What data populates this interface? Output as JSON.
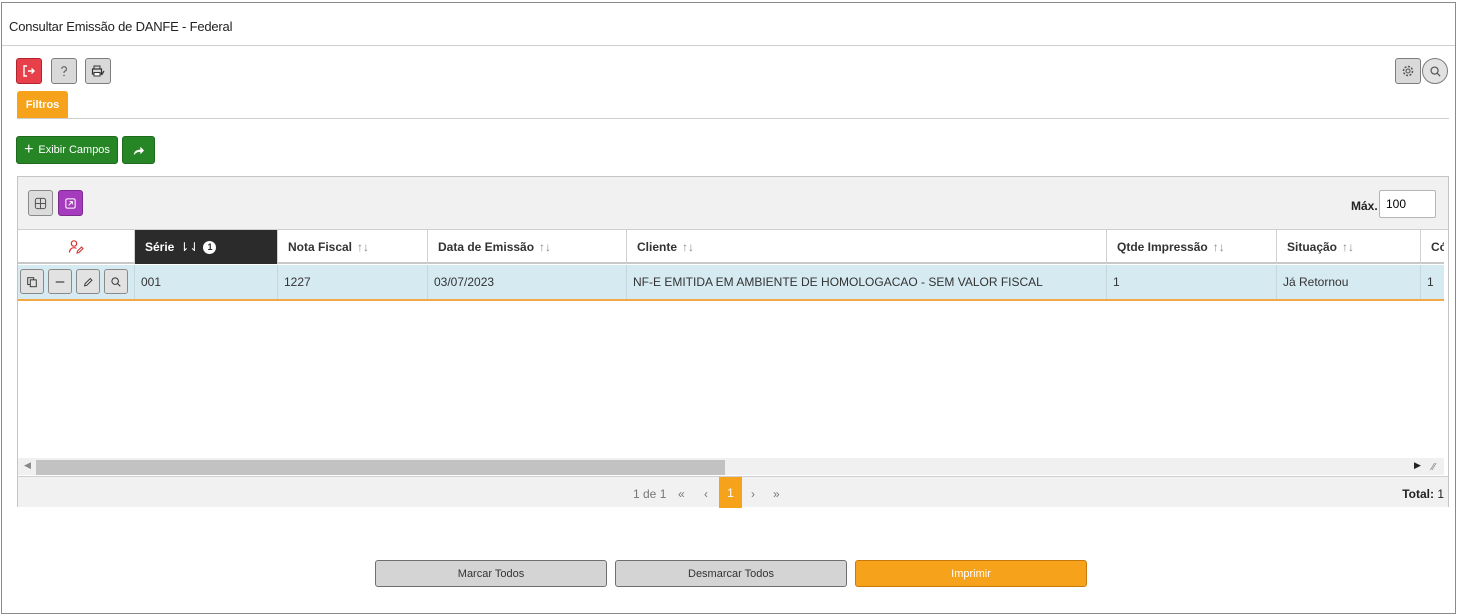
{
  "window": {
    "title": "Consultar Emissão de DANFE - Federal"
  },
  "toolbar": {
    "exit_icon": "exit-icon",
    "help_icon": "help-icon",
    "print_icon": "printer-icon",
    "settings_icon": "gear-icon",
    "search_icon": "search-icon"
  },
  "tabs": [
    {
      "label": "Filtros",
      "active": true
    }
  ],
  "actions": {
    "show_fields_label": "Exibir Campos"
  },
  "grid": {
    "max_label": "Máx.",
    "max_value": "100",
    "columns": [
      {
        "label": "Série",
        "sorted": true,
        "sort_order": "1"
      },
      {
        "label": "Nota Fiscal"
      },
      {
        "label": "Data de Emissão"
      },
      {
        "label": "Cliente"
      },
      {
        "label": "Qtde Impressão"
      },
      {
        "label": "Situação"
      },
      {
        "label": "Cód"
      }
    ],
    "rows": [
      {
        "serie": "001",
        "nota_fiscal": "1227",
        "data_emissao": "03/07/2023",
        "cliente": "NF-E EMITIDA EM AMBIENTE DE HOMOLOGACAO - SEM VALOR FISCAL",
        "qtde_impressao": "1",
        "situacao": "Já Retornou",
        "cod": "1"
      }
    ]
  },
  "pagination": {
    "summary": "1 de 1",
    "first": "«",
    "prev": "‹",
    "current": "1",
    "next": "›",
    "last": "»",
    "total_label": "Total:",
    "total_value": "1"
  },
  "footer": {
    "mark_all": "Marcar Todos",
    "unmark_all": "Desmarcar Todos",
    "print": "Imprimir"
  },
  "colors": {
    "accent": "#f7a21b",
    "success": "#268626",
    "danger": "#e8404a",
    "purple": "#a53bbd",
    "row_selected": "#d6eaf2"
  }
}
